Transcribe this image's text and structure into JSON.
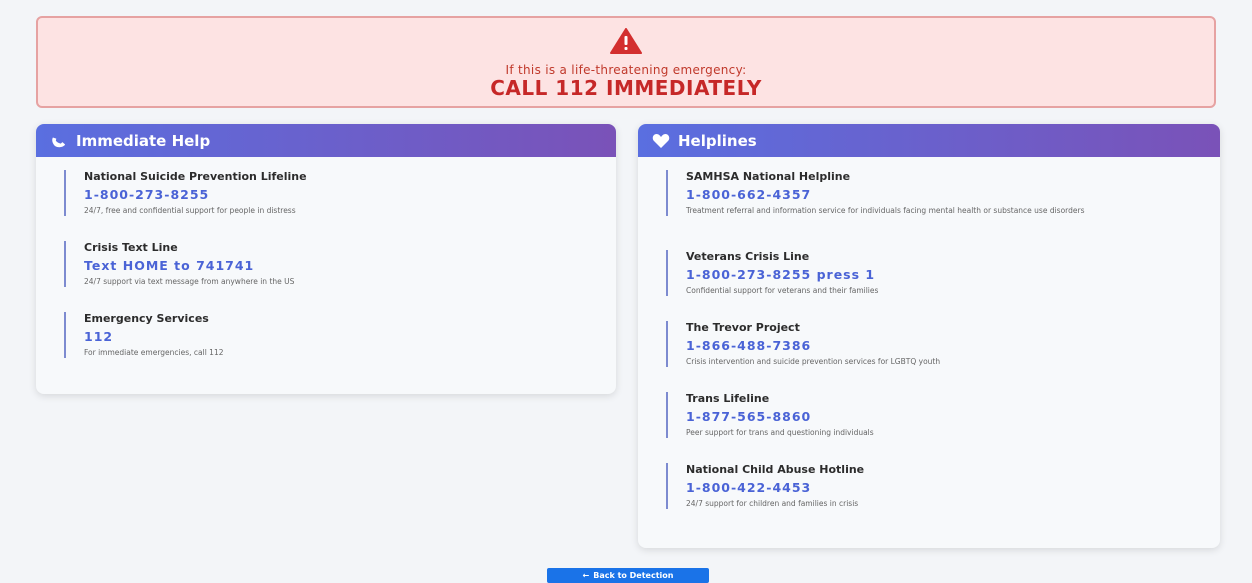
{
  "banner": {
    "subtitle": "If this is a life-threatening emergency:",
    "title": "CALL 112 IMMEDIATELY",
    "icon": "warning-triangle-icon",
    "bg_color": "#fde3e3",
    "text_color": "#c62828"
  },
  "immediate_help": {
    "title": "Immediate Help",
    "icon": "phone-icon",
    "items": [
      {
        "name": "National Suicide Prevention Lifeline",
        "number": "1-800-273-8255",
        "desc": "24/7, free and confidential support for people in distress"
      },
      {
        "name": "Crisis Text Line",
        "number": "Text HOME to 741741",
        "desc": "24/7 support via text message from anywhere in the US"
      },
      {
        "name": "Emergency Services",
        "number": "112",
        "desc": "For immediate emergencies, call 112"
      }
    ]
  },
  "helplines": {
    "title": "Helplines",
    "icon": "heart-icon",
    "items": [
      {
        "name": "SAMHSA National Helpline",
        "number": "1-800-662-4357",
        "desc": "Treatment referral and information service for individuals facing mental health or substance use disorders"
      },
      {
        "name": "Veterans Crisis Line",
        "number": "1-800-273-8255 press 1",
        "desc": "Confidential support for veterans and their families"
      },
      {
        "name": "The Trevor Project",
        "number": "1-866-488-7386",
        "desc": "Crisis intervention and suicide prevention services for LGBTQ youth"
      },
      {
        "name": "Trans Lifeline",
        "number": "1-877-565-8860",
        "desc": "Peer support for trans and questioning individuals"
      },
      {
        "name": "National Child Abuse Hotline",
        "number": "1-800-422-4453",
        "desc": "24/7 support for children and families in crisis"
      }
    ]
  },
  "footer": {
    "back_label": "Back to Detection",
    "back_icon": "arrow-left-icon",
    "button_color": "#1a73e8"
  },
  "colors": {
    "header_gradient_start": "#5a6fe0",
    "header_gradient_end": "#7a52b8",
    "link_color": "#4a63d6"
  }
}
